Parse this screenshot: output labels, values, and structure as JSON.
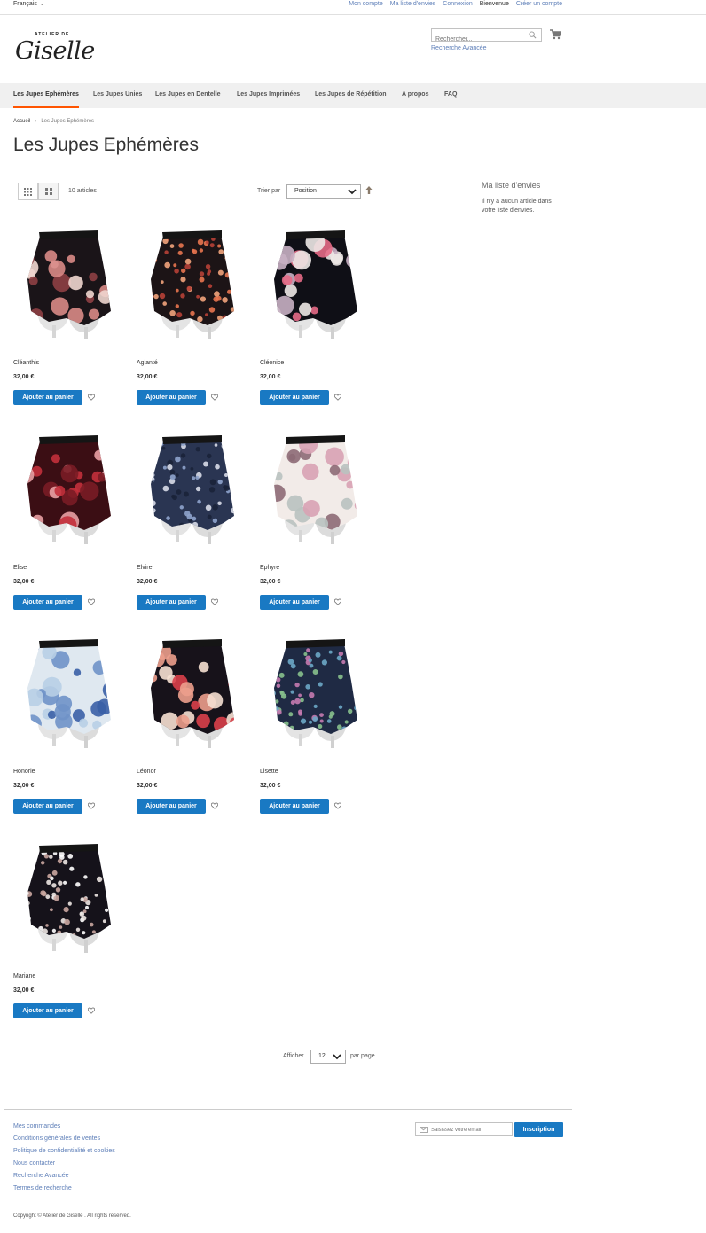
{
  "topbar": {
    "language": "Français",
    "links": [
      "Mon compte",
      "Ma liste d'envies",
      "Connexion"
    ],
    "welcome": "Bienvenue",
    "create_account": "Créer un compte"
  },
  "header": {
    "logo_small": "ATELIER DE",
    "logo_big": "Giselle",
    "search_placeholder": "Rechercher...",
    "advanced_search": "Recherche Avancée"
  },
  "nav": {
    "items": [
      "Les Jupes Ephémères",
      "Les Jupes Unies",
      "Les Jupes en Dentelle",
      "Les Jupes Imprimées",
      "Les Jupes de Répétition",
      "A propos",
      "FAQ"
    ],
    "active": 0
  },
  "breadcrumb": {
    "home": "Accueil",
    "separator": "›",
    "current": "Les Jupes Ephémères"
  },
  "page_title": "Les Jupes Ephémères",
  "toolbar": {
    "count": "10 articles",
    "sort_label": "Trier par",
    "sort_value": "Position"
  },
  "wishlist": {
    "title": "Ma liste d'envies",
    "empty_text": "Il n'y a aucun article dans votre liste d'envies."
  },
  "products": [
    {
      "name": "Cléanthis",
      "price": "32,00 €",
      "button": "Ajouter au panier",
      "pattern": "floral-pink-black",
      "bg": "#1a1418",
      "c1": "#d98a86",
      "c2": "#8e3f44",
      "c3": "#f0d6cf"
    },
    {
      "name": "Aglanté",
      "price": "32,00 €",
      "button": "Ajouter au panier",
      "pattern": "small-orange-flowers",
      "bg": "#1c1416",
      "c1": "#e8744f",
      "c2": "#f2a37b",
      "c3": "#b74036"
    },
    {
      "name": "Cléonice",
      "price": "32,00 €",
      "button": "Ajouter au panier",
      "pattern": "white-lily-black",
      "bg": "#0f0f16",
      "c1": "#ede8e6",
      "c2": "#c8b0c3",
      "c3": "#e56a86"
    },
    {
      "name": "Elise",
      "price": "32,00 €",
      "button": "Ajouter au panier",
      "pattern": "red-roses",
      "bg": "#3b0e14",
      "c1": "#c3303b",
      "c2": "#e9a0a3",
      "c3": "#7a1c25"
    },
    {
      "name": "Elvire",
      "price": "32,00 €",
      "button": "Ajouter au panier",
      "pattern": "blue-ditsy",
      "bg": "#2a3552",
      "c1": "#8ea3cc",
      "c2": "#d8dbe8",
      "c3": "#1a2238"
    },
    {
      "name": "Ephyre",
      "price": "32,00 €",
      "button": "Ajouter au panier",
      "pattern": "pink-blossom-white",
      "bg": "#f2ebe8",
      "c1": "#d8a2b4",
      "c2": "#8d6a76",
      "c3": "#b9c2c0"
    },
    {
      "name": "Honorie",
      "price": "32,00 €",
      "button": "Ajouter au panier",
      "pattern": "blue-flowers-white",
      "bg": "#dfe8f0",
      "c1": "#6f92c8",
      "c2": "#3a5fa6",
      "c3": "#b8cfe6"
    },
    {
      "name": "Léonor",
      "price": "32,00 €",
      "button": "Ajouter au panier",
      "pattern": "big-lilies-black",
      "bg": "#17121a",
      "c1": "#ec9f8c",
      "c2": "#d9404a",
      "c3": "#f6e0d2"
    },
    {
      "name": "Lisette",
      "price": "32,00 €",
      "button": "Ajouter au panier",
      "pattern": "multicolour-ditsy",
      "bg": "#1f2a44",
      "c1": "#6ba7c7",
      "c2": "#c47ab0",
      "c3": "#87c08d"
    },
    {
      "name": "Mariane",
      "price": "32,00 €",
      "button": "Ajouter au panier",
      "pattern": "white-dots-black",
      "bg": "#15121a",
      "c1": "#ece6e2",
      "c2": "#c9a6a0",
      "c3": "#ffffff"
    }
  ],
  "pager": {
    "label": "Afficher",
    "limit": "12",
    "after": "par page"
  },
  "footer": {
    "links": [
      "Mes commandes",
      "Conditions générales de ventes",
      "Politique de confidentialité et cookies",
      "Nous contacter",
      "Recherche Avancée",
      "Termes de recherche"
    ],
    "newsletter_placeholder": "Saisissez votre email",
    "newsletter_button": "Inscription",
    "copyright": "Copyright © Atelier de Giselle . All rights reserved."
  },
  "colors": {
    "accent": "#1979c3",
    "nav_active": "#ff5501",
    "link": "#5e7fb8"
  }
}
